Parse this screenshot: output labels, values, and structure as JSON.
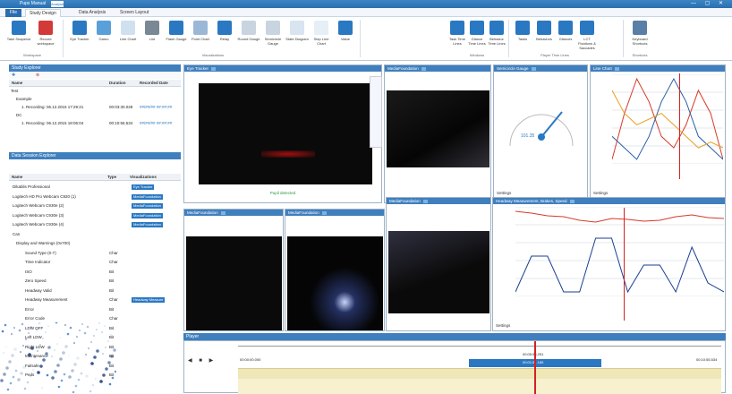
{
  "titlebar": {
    "title": "Pups  Manual",
    "badge": "Analyse",
    "controls": "— ▢ ✕"
  },
  "menu": {
    "file": "File",
    "tabs": [
      "Study Design",
      "Data Analysis",
      "Screen Layout"
    ]
  },
  "ribbon": {
    "workspace": [
      {
        "label": "Take Snapshot",
        "color": "#2a78c2"
      },
      {
        "label": "Record workspace",
        "color": "#d23a3a"
      }
    ],
    "workspace_group": "Workspace",
    "viz": [
      {
        "label": "Eye Tracker",
        "color": "#2a78c2"
      },
      {
        "label": "Gamo",
        "color": "#5aa0d8"
      },
      {
        "label": "Line Chart",
        "color": "#cfe0f0"
      },
      {
        "label": "List",
        "color": "#7a8794"
      },
      {
        "label": "Flash Gauge",
        "color": "#2a78c2"
      },
      {
        "label": "Point Chart",
        "color": "#9ab8d6"
      },
      {
        "label": "Relay",
        "color": "#2a78c2"
      },
      {
        "label": "Round Gauge",
        "color": "#c8d4e0"
      },
      {
        "label": "Semicircle Gauge",
        "color": "#c8d4e0"
      },
      {
        "label": "State Diagram",
        "color": "#d8e4f0"
      },
      {
        "label": "Step Line Chart",
        "color": "#e6eef6"
      },
      {
        "label": "Value",
        "color": "#2a78c2"
      }
    ],
    "viz_group": "Visualizations",
    "windows": [
      {
        "label": "Task Time Lines"
      },
      {
        "label": "Glance Time Lines"
      },
      {
        "label": "Behavior Time Lines"
      }
    ],
    "windows_group": "Windows",
    "player": [
      {
        "label": "Tasks"
      },
      {
        "label": "Behaviors"
      },
      {
        "label": "Glances"
      },
      {
        "label": "LCT Fixations & Saccades"
      }
    ],
    "player_group": "Player Time Lines",
    "shortcut": {
      "label": "Keyboard Shortcuts"
    },
    "shortcut_group": "Shortcuts"
  },
  "study": {
    "title": "Study Explorer",
    "cols": [
      "Name",
      "Duration",
      "Recorded Date"
    ],
    "rows": [
      {
        "name": "Test",
        "duration": "",
        "date": ""
      },
      {
        "name": "Example",
        "duration": "",
        "date": ""
      },
      {
        "name": "1. Recording: 06.12.2015 17:29:21",
        "duration": "00:03:30.028",
        "date": "##/##/## ##:##:##"
      },
      {
        "name": "DC",
        "duration": "",
        "date": ""
      },
      {
        "name": "1. Recording: 06.12.2015 18:06:04",
        "duration": "00:10:55.534",
        "date": "##/##/## ##:##:##"
      }
    ]
  },
  "sessions": {
    "title": "Data Session Explorer",
    "cols": [
      "Name",
      "Type",
      "Visualizations"
    ],
    "rows": [
      {
        "name": "Dikablis Professional",
        "type": "",
        "viz": "Eye Tracker"
      },
      {
        "name": "Logitech HD Pro Webcam C920 (1)",
        "type": "",
        "viz": "MediaFoundation"
      },
      {
        "name": "Logitech Webcam C930e (2)",
        "type": "",
        "viz": "MediaFoundation"
      },
      {
        "name": "Logitech Webcam C930e (3)",
        "type": "",
        "viz": "MediaFoundation"
      },
      {
        "name": "Logitech Webcam C930e (4)",
        "type": "",
        "viz": "MediaFoundation"
      },
      {
        "name": "Can",
        "type": "",
        "viz": ""
      },
      {
        "name": "Display and Warnings (0x700)",
        "type": "",
        "viz": ""
      },
      {
        "name": "Sound Type (0-7)",
        "type": "Char",
        "viz": ""
      },
      {
        "name": "Time Indicator",
        "type": "Char",
        "viz": ""
      },
      {
        "name": "ISO",
        "type": "Bit",
        "viz": ""
      },
      {
        "name": "Zero Speed",
        "type": "Bit",
        "viz": ""
      },
      {
        "name": "Headway Valid",
        "type": "Bit",
        "viz": ""
      },
      {
        "name": "Headway Measurement",
        "type": "Char",
        "viz": "Headway Measure"
      },
      {
        "name": "Error",
        "type": "Bit",
        "viz": ""
      },
      {
        "name": "Error Code",
        "type": "Char",
        "viz": ""
      },
      {
        "name": "LDW OFF",
        "type": "Bit",
        "viz": ""
      },
      {
        "name": "Left LDW",
        "type": "Bit",
        "viz": ""
      },
      {
        "name": "Right LDW",
        "type": "Bit",
        "viz": ""
      },
      {
        "name": "Maintenance",
        "type": "Bit",
        "viz": ""
      },
      {
        "name": "Failsafe",
        "type": "Bit",
        "viz": ""
      },
      {
        "name": "Peds",
        "type": "Bit",
        "viz": ""
      }
    ]
  },
  "viewports": {
    "eye": "Eye Tracker",
    "eye_status": "Pupil detected",
    "media1": "MediaFoundation",
    "media2": "MediaFoundation",
    "media3": "MediaFoundation",
    "media4": "MediaFoundation",
    "gauge": "Semicircle Gauge",
    "gauge_value": "101.35",
    "line": "Line Chart",
    "headway": "Headway Measurement, Brakes, Speed",
    "settings": "Settings"
  },
  "player": {
    "title": "Player",
    "start": "00:00:00.000",
    "end": "00:10:55.534",
    "cursor": "00:05:58.251",
    "cursor2": "00:01:51.180",
    "tick": "00:00:00.000"
  },
  "chart_data": [
    {
      "type": "line",
      "title": "",
      "xlabel": "",
      "ylabel": "",
      "series": [
        {
          "name": "",
          "values": [
            0.2,
            0.6,
            0.9,
            0.7,
            0.4,
            0.3,
            0.5,
            0.8,
            0.6,
            0.2
          ]
        },
        {
          "name": "",
          "values": [
            0.4,
            0.3,
            0.2,
            0.4,
            0.7,
            0.9,
            0.7,
            0.4,
            0.3,
            0.2
          ]
        },
        {
          "name": "",
          "values": [
            0.8,
            0.6,
            0.5,
            0.55,
            0.6,
            0.5,
            0.4,
            0.3,
            0.35,
            0.3
          ]
        }
      ]
    },
    {
      "type": "line",
      "title": "",
      "xlabel": "",
      "ylabel": "",
      "series": [
        {
          "name": "",
          "values": [
            110,
            108,
            105,
            104,
            100,
            98,
            102,
            101,
            99,
            100,
            104,
            106,
            103,
            102
          ]
        },
        {
          "name": "",
          "values": [
            20,
            60,
            60,
            20,
            20,
            80,
            80,
            20,
            50,
            50,
            20,
            70,
            30,
            20
          ]
        }
      ]
    }
  ]
}
